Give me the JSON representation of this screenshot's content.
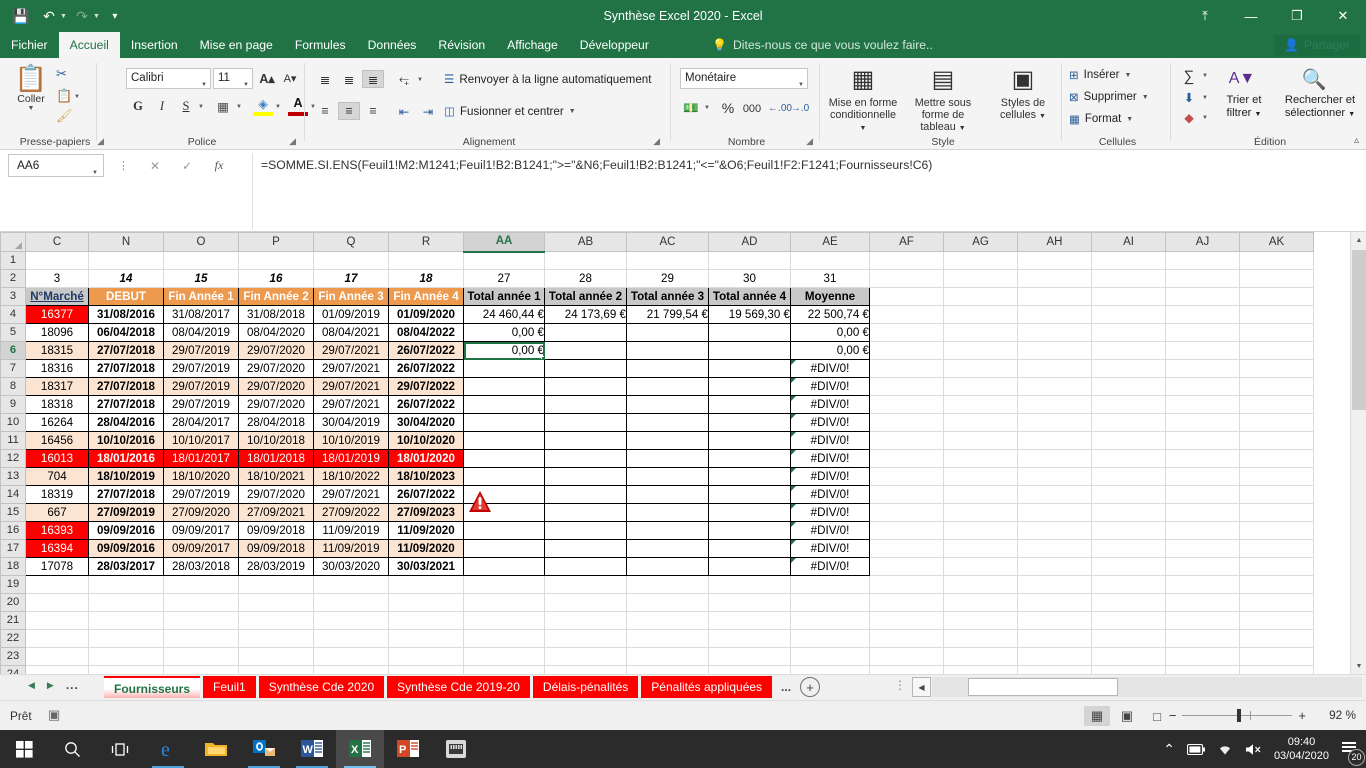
{
  "window": {
    "title": "Synthèse Excel 2020 - Excel",
    "quick_access": [
      "save-icon",
      "undo-icon",
      "redo-icon",
      "customize-icon"
    ],
    "ribbon_display_label": "⤒",
    "minimize_label": "—",
    "restore_label": "❐",
    "close_label": "✕"
  },
  "ribbon_tabs": [
    {
      "label": "Fichier",
      "active": false
    },
    {
      "label": "Accueil",
      "active": true
    },
    {
      "label": "Insertion",
      "active": false
    },
    {
      "label": "Mise en page",
      "active": false
    },
    {
      "label": "Formules",
      "active": false
    },
    {
      "label": "Données",
      "active": false
    },
    {
      "label": "Révision",
      "active": false
    },
    {
      "label": "Affichage",
      "active": false
    },
    {
      "label": "Développeur",
      "active": false
    }
  ],
  "tellme": {
    "placeholder": "Dites-nous ce que vous voulez faire..",
    "icon": "lightbulb-icon"
  },
  "share": {
    "label": "Partager",
    "icon": "person-add-icon"
  },
  "ribbon": {
    "groups": [
      {
        "name": "Presse-papiers",
        "label": "Presse-papiers"
      },
      {
        "name": "Police",
        "label": "Police"
      },
      {
        "name": "Alignement",
        "label": "Alignement"
      },
      {
        "name": "Nombre",
        "label": "Nombre"
      },
      {
        "name": "Style",
        "label": "Style"
      },
      {
        "name": "Cellules",
        "label": "Cellules"
      },
      {
        "name": "Edition",
        "label": "Édition"
      }
    ],
    "clipboard": {
      "paste_label": "Coller",
      "cut": "cut-icon",
      "copy": "copy-icon",
      "format_painter": "format-painter-icon"
    },
    "font": {
      "family": "Calibri",
      "size": "11",
      "grow_label": "A",
      "shrink_label": "A",
      "bold_label": "G",
      "italic_label": "I",
      "underline_label": "S",
      "borders_icon": "borders-icon",
      "fill_icon": "fill-color-icon",
      "font_color_icon": "font-color-icon"
    },
    "alignment": {
      "wrap_label": "Renvoyer à la ligne automatiquement",
      "merge_label": "Fusionner et centrer",
      "orientation_icon": "orientation-icon",
      "indent_dec_icon": "decrease-indent-icon",
      "indent_inc_icon": "increase-indent-icon"
    },
    "number": {
      "format": "Monétaire",
      "currency_icon": "currency-icon",
      "percent_label": "%",
      "thousands_label": "000",
      "inc_dec_label": "←.00",
      "dec_dec_label": "→.0"
    },
    "style": [
      {
        "label": "Mise en forme conditionnelle",
        "icon": "conditional-formatting-icon"
      },
      {
        "label": "Mettre sous forme de tableau",
        "icon": "format-as-table-icon"
      },
      {
        "label": "Styles de cellules",
        "icon": "cell-styles-icon"
      }
    ],
    "cells": [
      {
        "label": "Insérer",
        "icon": "insert-cells-icon"
      },
      {
        "label": "Supprimer",
        "icon": "delete-cells-icon"
      },
      {
        "label": "Format",
        "icon": "format-cells-icon"
      }
    ],
    "edition": {
      "autosum_icon": "autosum-icon",
      "fill_icon": "fill-down-icon",
      "clear_icon": "clear-eraser-icon",
      "sort_filter_label": "Trier et filtrer",
      "find_select_label": "Rechercher et sélectionner"
    }
  },
  "formula_bar": {
    "name_box": "AA6",
    "cancel_icon": "cancel-icon",
    "enter_icon": "confirm-icon",
    "fx_icon": "insert-function-icon",
    "formula": "=SOMME.SI.ENS(Feuil1!M2:M1241;Feuil1!B2:B1241;\">=\"&N6;Feuil1!B2:B1241;\"<=\"&O6;Feuil1!F2:F1241;Fournisseurs!C6)"
  },
  "grid": {
    "columns": [
      "C",
      "N",
      "O",
      "P",
      "Q",
      "R",
      "AA",
      "AB",
      "AC",
      "AD",
      "AE",
      "AF",
      "AG",
      "AH",
      "AI",
      "AJ",
      "AK"
    ],
    "selected_column": "AA",
    "selected_row": 6,
    "rows": [
      "1",
      "2",
      "3",
      "4",
      "5",
      "6",
      "7",
      "8",
      "9",
      "10",
      "11",
      "12",
      "13",
      "14",
      "15",
      "16",
      "17",
      "18",
      "19",
      "20",
      "21",
      "22",
      "23",
      "24"
    ],
    "row2": [
      "3",
      "14",
      "15",
      "16",
      "17",
      "18",
      "27",
      "28",
      "29",
      "30",
      "31"
    ],
    "row3": [
      "N°Marché",
      "DEBUT",
      "Fin Année 1",
      "Fin Année 2",
      "Fin Année 3",
      "Fin Année 4",
      "Total année 1",
      "Total année 2",
      "Total année 3",
      "Total année 4",
      "Moyenne"
    ],
    "data": [
      {
        "row": "4",
        "marche": "16377",
        "marche_fill": "red",
        "debut": "31/08/2016",
        "a1": "31/08/2017",
        "a2": "31/08/2018",
        "a3": "01/09/2019",
        "a4": "01/09/2020",
        "t1": "24 460,44 €",
        "t2": "24 173,69 €",
        "t3": "21 799,54 €",
        "t4": "19 569,30 €",
        "moy": "22 500,74 €",
        "moy_err": false,
        "band": "none"
      },
      {
        "row": "5",
        "marche": "18096",
        "marche_fill": "none",
        "debut": "06/04/2018",
        "a1": "08/04/2019",
        "a2": "08/04/2020",
        "a3": "08/04/2021",
        "a4": "08/04/2022",
        "t1": "0,00 €",
        "t2": "",
        "t3": "",
        "t4": "",
        "moy": "0,00 €",
        "moy_err": false,
        "band": "none"
      },
      {
        "row": "6",
        "marche": "18315",
        "marche_fill": "peach",
        "debut": "27/07/2018",
        "a1": "29/07/2019",
        "a2": "29/07/2020",
        "a3": "29/07/2021",
        "a4": "26/07/2022",
        "t1": "0,00 €",
        "t2": "",
        "t3": "",
        "t4": "",
        "moy": "0,00 €",
        "moy_err": false,
        "band": "peach"
      },
      {
        "row": "7",
        "marche": "18316",
        "marche_fill": "none",
        "debut": "27/07/2018",
        "a1": "29/07/2019",
        "a2": "29/07/2020",
        "a3": "29/07/2021",
        "a4": "26/07/2022",
        "t1": "",
        "t2": "",
        "t3": "",
        "t4": "",
        "moy": "#DIV/0!",
        "moy_err": true,
        "band": "none"
      },
      {
        "row": "8",
        "marche": "18317",
        "marche_fill": "peach",
        "debut": "27/07/2018",
        "a1": "29/07/2019",
        "a2": "29/07/2020",
        "a3": "29/07/2021",
        "a4": "29/07/2022",
        "t1": "",
        "t2": "",
        "t3": "",
        "t4": "",
        "moy": "#DIV/0!",
        "moy_err": true,
        "band": "peach"
      },
      {
        "row": "9",
        "marche": "18318",
        "marche_fill": "none",
        "debut": "27/07/2018",
        "a1": "29/07/2019",
        "a2": "29/07/2020",
        "a3": "29/07/2021",
        "a4": "26/07/2022",
        "t1": "",
        "t2": "",
        "t3": "",
        "t4": "",
        "moy": "#DIV/0!",
        "moy_err": true,
        "band": "none"
      },
      {
        "row": "10",
        "marche": "16264",
        "marche_fill": "none",
        "debut": "28/04/2016",
        "a1": "28/04/2017",
        "a2": "28/04/2018",
        "a3": "30/04/2019",
        "a4": "30/04/2020",
        "t1": "",
        "t2": "",
        "t3": "",
        "t4": "",
        "moy": "#DIV/0!",
        "moy_err": true,
        "band": "none"
      },
      {
        "row": "11",
        "marche": "16456",
        "marche_fill": "peach",
        "debut": "10/10/2016",
        "a1": "10/10/2017",
        "a2": "10/10/2018",
        "a3": "10/10/2019",
        "a4": "10/10/2020",
        "t1": "",
        "t2": "",
        "t3": "",
        "t4": "",
        "moy": "#DIV/0!",
        "moy_err": true,
        "band": "peach"
      },
      {
        "row": "12",
        "marche": "16013",
        "marche_fill": "red",
        "debut": "18/01/2016",
        "a1": "18/01/2017",
        "a2": "18/01/2018",
        "a3": "18/01/2019",
        "a4": "18/01/2020",
        "t1": "",
        "t2": "",
        "t3": "",
        "t4": "",
        "moy": "#DIV/0!",
        "moy_err": true,
        "band": "red"
      },
      {
        "row": "13",
        "marche": "704",
        "marche_fill": "peach",
        "debut": "18/10/2019",
        "a1": "18/10/2020",
        "a2": "18/10/2021",
        "a3": "18/10/2022",
        "a4": "18/10/2023",
        "t1": "",
        "t2": "",
        "t3": "",
        "t4": "",
        "moy": "#DIV/0!",
        "moy_err": true,
        "band": "peach"
      },
      {
        "row": "14",
        "marche": "18319",
        "marche_fill": "none",
        "debut": "27/07/2018",
        "a1": "29/07/2019",
        "a2": "29/07/2020",
        "a3": "29/07/2021",
        "a4": "26/07/2022",
        "t1": "",
        "t2": "",
        "t3": "",
        "t4": "",
        "moy": "#DIV/0!",
        "moy_err": true,
        "band": "none"
      },
      {
        "row": "15",
        "marche": "667",
        "marche_fill": "peach",
        "debut": "27/09/2019",
        "a1": "27/09/2020",
        "a2": "27/09/2021",
        "a3": "27/09/2022",
        "a4": "27/09/2023",
        "t1": "",
        "t2": "",
        "t3": "",
        "t4": "",
        "moy": "#DIV/0!",
        "moy_err": true,
        "band": "peach"
      },
      {
        "row": "16",
        "marche": "16393",
        "marche_fill": "red",
        "debut": "09/09/2016",
        "a1": "09/09/2017",
        "a2": "09/09/2018",
        "a3": "11/09/2019",
        "a4": "11/09/2020",
        "t1": "",
        "t2": "",
        "t3": "",
        "t4": "",
        "moy": "#DIV/0!",
        "moy_err": true,
        "band": "none"
      },
      {
        "row": "17",
        "marche": "16394",
        "marche_fill": "red",
        "debut": "09/09/2016",
        "a1": "09/09/2017",
        "a2": "09/09/2018",
        "a3": "11/09/2019",
        "a4": "11/09/2020",
        "t1": "",
        "t2": "",
        "t3": "",
        "t4": "",
        "moy": "#DIV/0!",
        "moy_err": true,
        "band": "peach"
      },
      {
        "row": "18",
        "marche": "17078",
        "marche_fill": "none",
        "debut": "28/03/2017",
        "a1": "28/03/2018",
        "a2": "28/03/2019",
        "a3": "30/03/2020",
        "a4": "30/03/2021",
        "t1": "",
        "t2": "",
        "t3": "",
        "t4": "",
        "moy": "#DIV/0!",
        "moy_err": true,
        "band": "none"
      }
    ],
    "warning_icon": "warning-triangle-icon"
  },
  "sheet_tabs": {
    "first_icon": "first-sheet-icon",
    "prev_icon": "prev-sheet-icon",
    "left_dots": "...",
    "right_dots": "...",
    "add_label": "+",
    "tabs": [
      {
        "label": "Fournisseurs",
        "active": true
      },
      {
        "label": "Feuil1",
        "active": false
      },
      {
        "label": "Synthèse Cde 2020",
        "active": false
      },
      {
        "label": "Synthèse Cde 2019-20",
        "active": false
      },
      {
        "label": "Délais-pénalités",
        "active": false
      },
      {
        "label": "Pénalités appliquées",
        "active": false
      }
    ]
  },
  "status": {
    "mode": "Prêt",
    "macro_icon": "record-macro-icon",
    "views": [
      {
        "name": "normal-view",
        "icon": "grid-icon",
        "active": true
      },
      {
        "name": "page-layout-view",
        "icon": "page-icon",
        "active": false
      },
      {
        "name": "page-break-view",
        "icon": "break-icon",
        "active": false
      }
    ],
    "zoom_out": "−",
    "zoom_in": "+",
    "zoom": "92 %"
  },
  "taskbar": {
    "items": [
      {
        "name": "start-button",
        "icon": "windows-icon",
        "running": false,
        "active": false
      },
      {
        "name": "search-button",
        "icon": "search-icon",
        "running": false,
        "active": false
      },
      {
        "name": "task-view-button",
        "icon": "task-view-icon",
        "running": false,
        "active": false
      },
      {
        "name": "edge-button",
        "icon": "edge-icon",
        "running": true,
        "active": false
      },
      {
        "name": "explorer-button",
        "icon": "folder-icon",
        "running": false,
        "active": false
      },
      {
        "name": "outlook-button",
        "icon": "outlook-icon",
        "running": true,
        "active": false
      },
      {
        "name": "word-button",
        "icon": "word-icon",
        "running": true,
        "active": false
      },
      {
        "name": "excel-button",
        "icon": "excel-icon",
        "running": true,
        "active": true
      },
      {
        "name": "powerpoint-button",
        "icon": "powerpoint-icon",
        "running": false,
        "active": false
      },
      {
        "name": "network-app-button",
        "icon": "network-app-icon",
        "running": false,
        "active": false
      }
    ],
    "tray": {
      "chevron": "⌃",
      "battery_icon": "battery-icon",
      "wifi_icon": "wifi-icon",
      "volume_icon": "volume-muted-icon",
      "time": "09:40",
      "date": "03/04/2020",
      "notifications": "20"
    }
  }
}
